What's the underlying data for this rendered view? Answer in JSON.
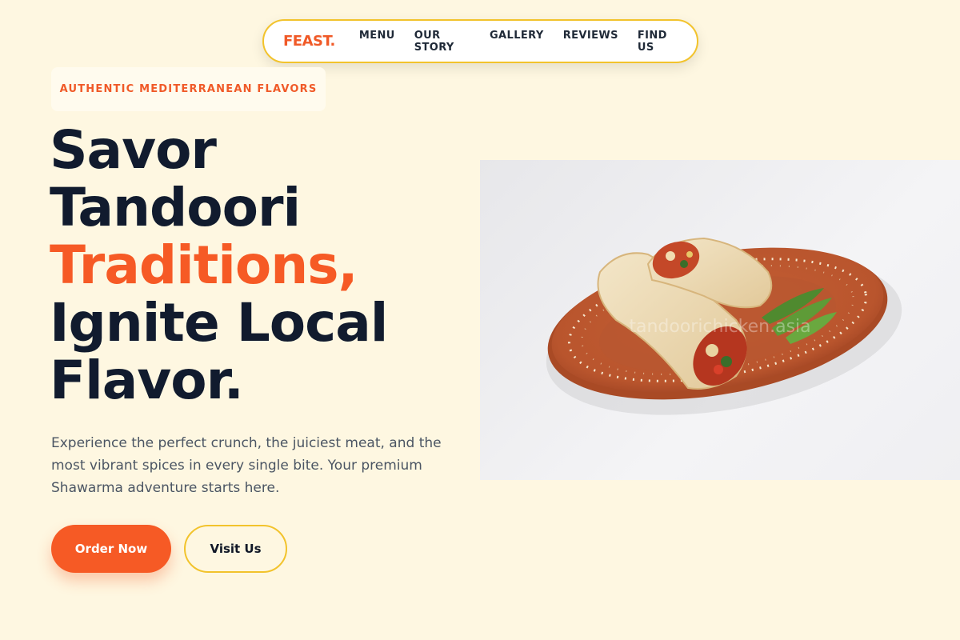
{
  "nav": {
    "logo": "FEAST.",
    "links": [
      "MENU",
      "OUR STORY",
      "GALLERY",
      "REVIEWS",
      "FIND US"
    ]
  },
  "hero": {
    "badge": "AUTHENTIC MEDITERRANEAN FLAVORS",
    "headline": {
      "line1": "Savor",
      "line2": "Tandoori",
      "line3": "Traditions,",
      "line4": "Ignite Local",
      "line5": "Flavor."
    },
    "description": "Experience the perfect crunch, the juiciest meat, and the most vibrant spices in every single bite. Your premium Shawarma adventure starts here.",
    "primary_button": "Order Now",
    "secondary_button": "Visit Us",
    "image_watermark": "tandoorichicken.asia"
  },
  "colors": {
    "background": "#fef7e1",
    "accent": "#f65a25",
    "border": "#f2c32c",
    "heading": "#111b2e"
  }
}
